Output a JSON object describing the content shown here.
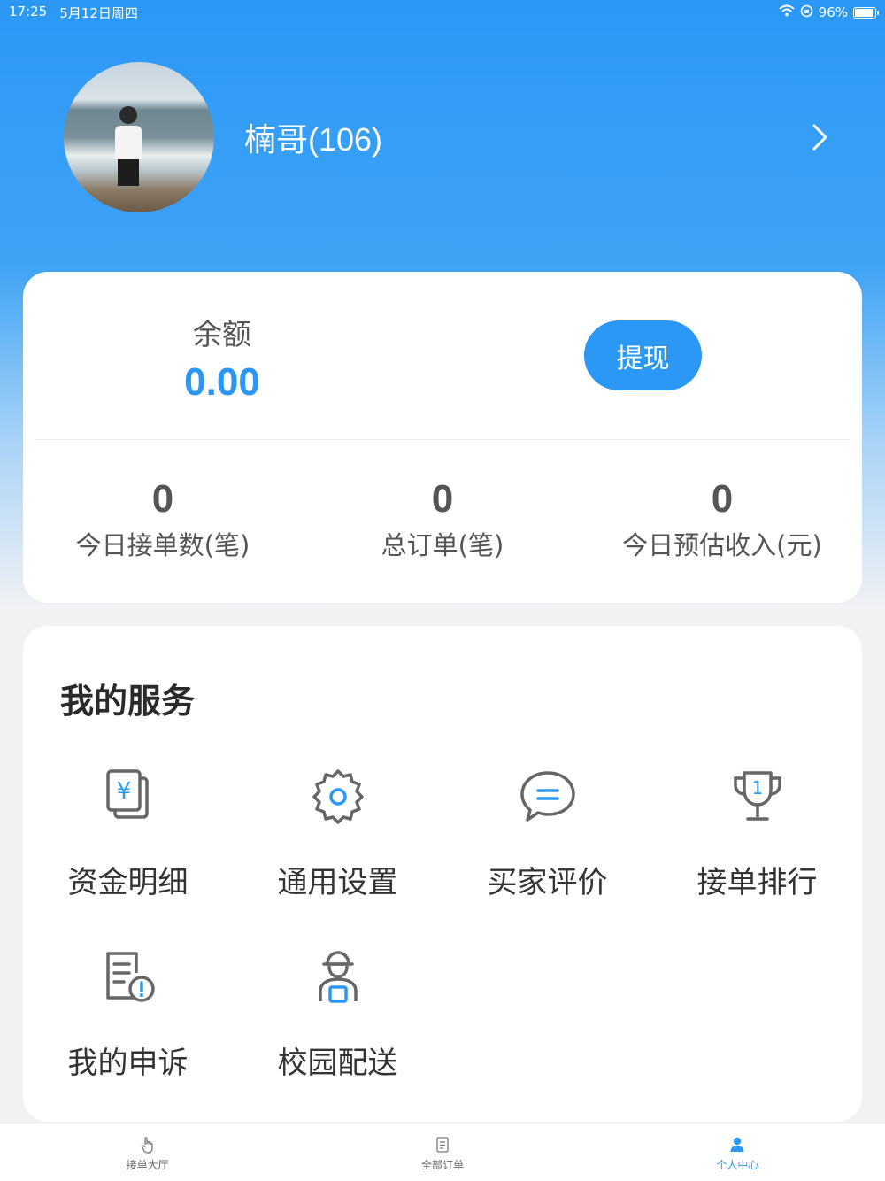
{
  "status_bar": {
    "time": "17:25",
    "date": "5月12日周四",
    "battery": "96%",
    "battery_level": 0.96
  },
  "profile": {
    "name": "楠哥(106)"
  },
  "balance": {
    "label": "余额",
    "value": "0.00",
    "withdraw_label": "提现"
  },
  "stats": [
    {
      "value": "0",
      "label": "今日接单数(笔)"
    },
    {
      "value": "0",
      "label": "总订单(笔)"
    },
    {
      "value": "0",
      "label": "今日预估收入(元)"
    }
  ],
  "services": {
    "title": "我的服务",
    "items": [
      {
        "label": "资金明细",
        "icon": "money-detail-icon"
      },
      {
        "label": "通用设置",
        "icon": "gear-icon"
      },
      {
        "label": "买家评价",
        "icon": "chat-bubble-icon"
      },
      {
        "label": "接单排行",
        "icon": "trophy-icon"
      },
      {
        "label": "我的申诉",
        "icon": "appeal-document-icon"
      },
      {
        "label": "校园配送",
        "icon": "courier-icon"
      }
    ]
  },
  "tabbar": {
    "items": [
      {
        "label": "接单大厅",
        "icon": "hand-tap-icon",
        "active": false
      },
      {
        "label": "全部订单",
        "icon": "order-list-icon",
        "active": false
      },
      {
        "label": "个人中心",
        "icon": "person-icon",
        "active": true
      }
    ]
  },
  "colors": {
    "accent": "#2b98f6",
    "card": "#ffffff",
    "background": "#f2f2f4"
  }
}
